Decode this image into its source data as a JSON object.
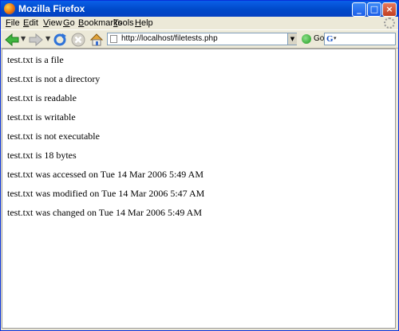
{
  "window": {
    "title": "Mozilla Firefox"
  },
  "menubar": {
    "items": [
      {
        "label": "File"
      },
      {
        "label": "Edit"
      },
      {
        "label": "View"
      },
      {
        "label": "Go"
      },
      {
        "label": "Bookmarks"
      },
      {
        "label": "Tools"
      },
      {
        "label": "Help"
      }
    ]
  },
  "toolbar": {
    "url": "http://localhost/filetests.php",
    "go_label": "Go",
    "search_value": ""
  },
  "page": {
    "lines": [
      "test.txt is a file",
      "test.txt is not a directory",
      "test.txt is readable",
      "test.txt is writable",
      "test.txt is not executable",
      "test.txt is 18 bytes",
      "test.txt was accessed on Tue 14 Mar 2006 5:49 AM",
      "test.txt was modified on Tue 14 Mar 2006 5:47 AM",
      "test.txt was changed on Tue 14 Mar 2006 5:49 AM"
    ]
  }
}
